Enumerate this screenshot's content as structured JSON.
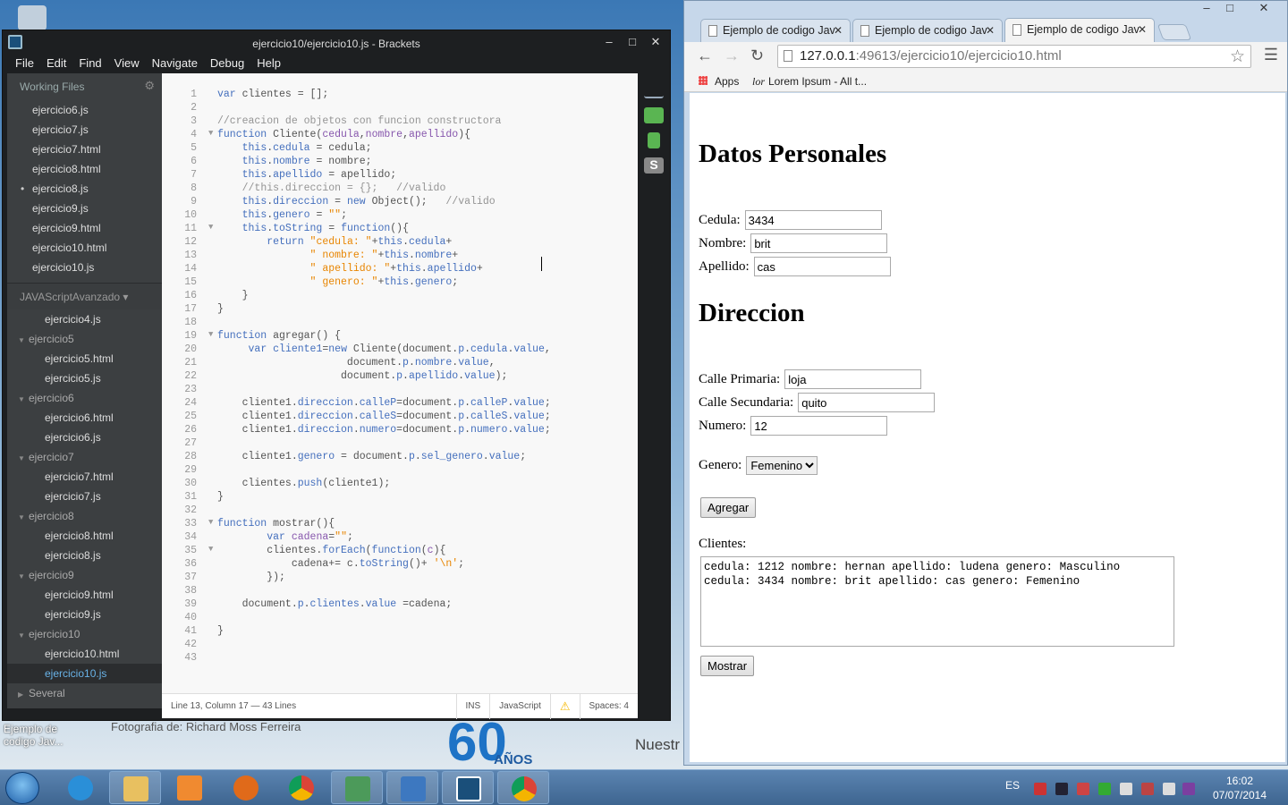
{
  "desktop": {
    "icon_label_line1": "Ejemplo de",
    "icon_label_line2": "codigo Jav...",
    "caption": "Fotografia de: Richard Moss Ferreira",
    "logo_number": "60",
    "logo_text": "AÑOS",
    "side_text": "Nuestr"
  },
  "brackets": {
    "title": "ejercicio10/ejercicio10.js - Brackets",
    "menu": [
      "File",
      "Edit",
      "Find",
      "View",
      "Navigate",
      "Debug",
      "Help"
    ],
    "working_files_label": "Working Files",
    "working_files": [
      {
        "name": "ejercicio6.js"
      },
      {
        "name": "ejercicio7.js"
      },
      {
        "name": "ejercicio7.html"
      },
      {
        "name": "ejercicio8.html"
      },
      {
        "name": "ejercicio8.js",
        "dirty": true
      },
      {
        "name": "ejercicio9.js"
      },
      {
        "name": "ejercicio9.html"
      },
      {
        "name": "ejercicio10.html"
      },
      {
        "name": "ejercicio10.js"
      }
    ],
    "project_label": "JAVAScriptAvanzado ▾",
    "tree_top_file": "ejercicio4.js",
    "tree": [
      {
        "dir": "ejercicio5",
        "files": [
          "ejercicio5.html",
          "ejercicio5.js"
        ]
      },
      {
        "dir": "ejercicio6",
        "files": [
          "ejercicio6.html",
          "ejercicio6.js"
        ]
      },
      {
        "dir": "ejercicio7",
        "files": [
          "ejercicio7.html",
          "ejercicio7.js"
        ]
      },
      {
        "dir": "ejercicio8",
        "files": [
          "ejercicio8.html",
          "ejercicio8.js"
        ]
      },
      {
        "dir": "ejercicio9",
        "files": [
          "ejercicio9.html",
          "ejercicio9.js"
        ]
      },
      {
        "dir": "ejercicio10",
        "files": [
          "ejercicio10.html",
          "ejercicio10.js"
        ]
      }
    ],
    "tree_collapsed": "Several",
    "status": {
      "position": "Line 13, Column 17 — 43 Lines",
      "mode": "INS",
      "language": "JavaScript",
      "spaces": "Spaces: 4"
    },
    "line_count": 43
  },
  "chrome": {
    "tabs": [
      {
        "label": "Ejemplo de codigo Jav"
      },
      {
        "label": "Ejemplo de codigo Jav"
      },
      {
        "label": "Ejemplo de codigo Jav"
      }
    ],
    "url_host": "127.0.0.1",
    "url_path": ":49613/ejercicio10/ejercicio10.html",
    "bookmarks": {
      "apps": "Apps",
      "lorem": "Lorem Ipsum - All t..."
    },
    "page": {
      "h1_personal": "Datos Personales",
      "h1_direccion": "Direccion",
      "cedula_label": "Cedula:",
      "cedula_value": "3434",
      "nombre_label": "Nombre:",
      "nombre_value": "brit",
      "apellido_label": "Apellido:",
      "apellido_value": "cas",
      "calle_p_label": "Calle Primaria:",
      "calle_p_value": "loja",
      "calle_s_label": "Calle Secundaria:",
      "calle_s_value": "quito",
      "numero_label": "Numero:",
      "numero_value": "12",
      "genero_label": "Genero:",
      "genero_value": "Femenino",
      "agregar_label": "Agregar",
      "clientes_label": "Clientes:",
      "clientes_text": "cedula: 1212 nombre: hernan apellido: ludena genero: Masculino\ncedula: 3434 nombre: brit apellido: cas genero: Femenino",
      "mostrar_label": "Mostrar"
    }
  },
  "taskbar": {
    "lang": "ES",
    "time": "16:02",
    "date": "07/07/2014"
  }
}
